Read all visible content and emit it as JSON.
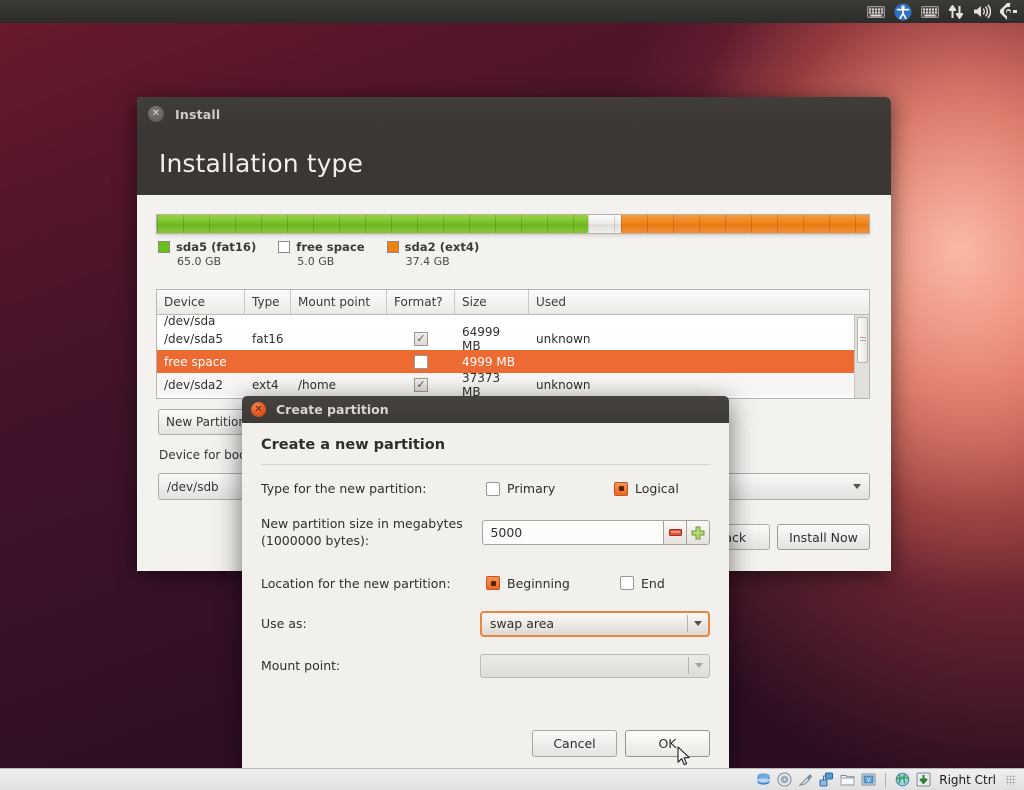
{
  "top_panel": {
    "icons": [
      "keyboard-icon",
      "accessibility-icon",
      "keyboard-layout-icon",
      "network-icon",
      "volume-icon",
      "gear-icon"
    ]
  },
  "installer": {
    "titlebar": {
      "title": "Install",
      "close_label": "✕"
    },
    "heading": "Installation type",
    "partition_bar": [
      {
        "name": "sda5",
        "color": "#69c11e",
        "percent": 60.5
      },
      {
        "name": "free space",
        "color": "#ffffff",
        "percent": 4.7
      },
      {
        "name": "sda2",
        "color": "#f07f14",
        "percent": 34.8
      }
    ],
    "legend": [
      {
        "name": "sda5 (fat16)",
        "size": "65.0 GB",
        "color": "#69c11e"
      },
      {
        "name": "free space",
        "size": "5.0 GB",
        "color": "#ffffff"
      },
      {
        "name": "sda2 (ext4)",
        "size": "37.4 GB",
        "color": "#f07f14"
      }
    ],
    "table": {
      "columns": [
        "Device",
        "Type",
        "Mount point",
        "Format?",
        "Size",
        "Used"
      ],
      "rows": [
        {
          "device": "/dev/sda",
          "type": "",
          "mount": "",
          "format": "none",
          "size": "",
          "used": "",
          "clipped": true,
          "selected": false
        },
        {
          "device": "/dev/sda5",
          "type": "fat16",
          "mount": "",
          "format": "checked",
          "size": "64999 MB",
          "used": "unknown",
          "clipped": false,
          "selected": false
        },
        {
          "device": "free space",
          "type": "",
          "mount": "",
          "format": "unchecked",
          "size": "4999 MB",
          "used": "",
          "clipped": false,
          "selected": true
        },
        {
          "device": "/dev/sda2",
          "type": "ext4",
          "mount": "/home",
          "format": "checked",
          "size": "37373 MB",
          "used": "unknown",
          "clipped": false,
          "selected": false
        }
      ],
      "checkmark": "✓"
    },
    "new_partition_button": "New Partition Table...",
    "device_for_boot_label": "Device for boot loader installation:",
    "device_for_boot_value": "/dev/sdb",
    "back_button": "Back",
    "install_now_button": "Install Now"
  },
  "dialog": {
    "titlebar": {
      "title": "Create partition",
      "close_label": "✕"
    },
    "heading": "Create a new partition",
    "type_label": "Type for the new partition:",
    "type_options": [
      {
        "label": "Primary",
        "selected": false
      },
      {
        "label": "Logical",
        "selected": true
      }
    ],
    "size_label": "New partition size in megabytes (1000000 bytes):",
    "size_value": "5000",
    "spinner": {
      "decrement": "−",
      "increment": "+"
    },
    "location_label": "Location for the new partition:",
    "location_options": [
      {
        "label": "Beginning",
        "selected": true
      },
      {
        "label": "End",
        "selected": false
      }
    ],
    "use_as_label": "Use as:",
    "use_as_value": "swap area",
    "mount_point_label": "Mount point:",
    "mount_point_value": "",
    "cancel_button": "Cancel",
    "ok_button": "OK"
  },
  "statusbar": {
    "icons": [
      "harddisk-icon",
      "optical-disk-icon",
      "usb-icon",
      "network-adapter-icon",
      "shared-folder-icon",
      "display-icon",
      "globe-icon",
      "download-icon"
    ],
    "host_key_label": "Right Ctrl"
  }
}
